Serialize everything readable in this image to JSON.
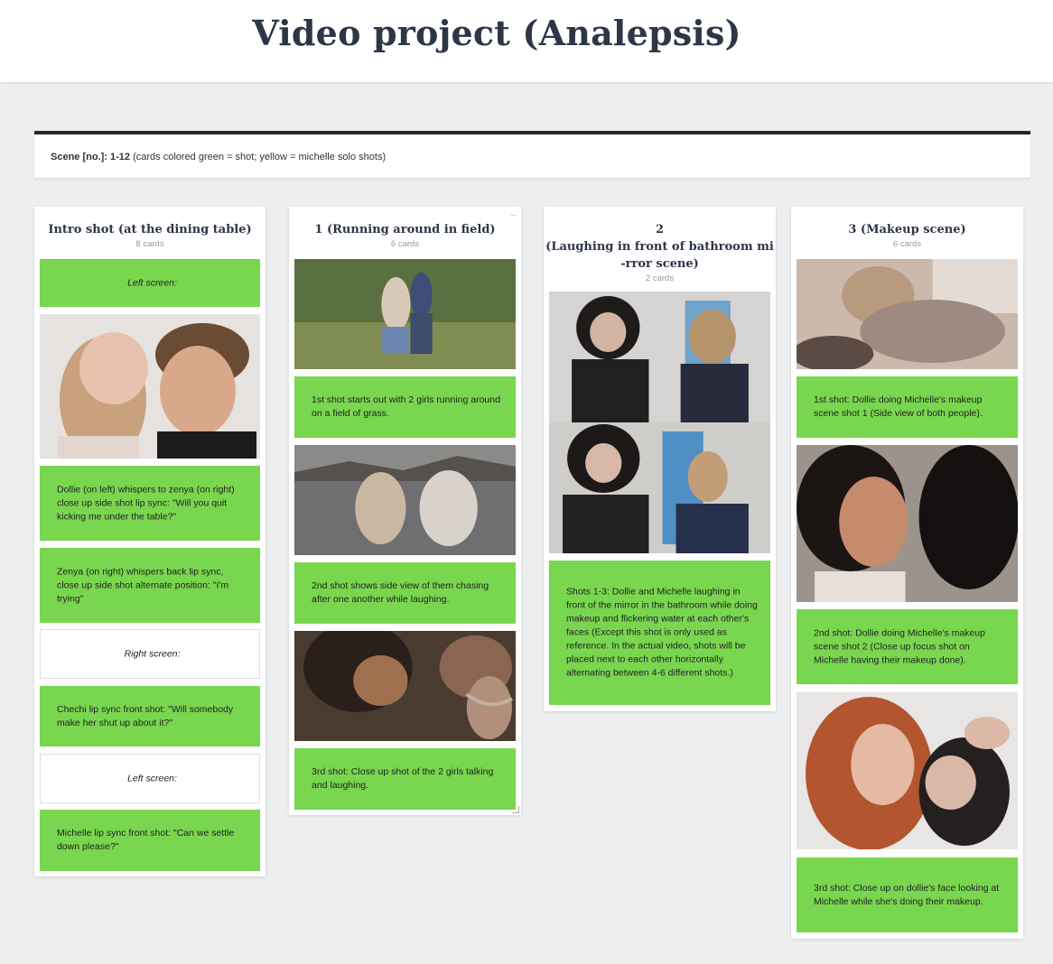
{
  "page": {
    "title": "Video project (Analepsis)"
  },
  "info": {
    "label": "Scene [no.]: 1-12",
    "description": " (cards colored green = shot; yellow = michelle solo shots)"
  },
  "colors": {
    "card_green": "#79d64f",
    "header_dark": "#25282c",
    "title_color": "#2d3646"
  },
  "columns": [
    {
      "title": "Intro shot (at the dining table)",
      "count": "8 cards",
      "cards": [
        {
          "type": "text",
          "color": "green",
          "text": "Left screen:"
        },
        {
          "type": "image",
          "description_icon": "image-icon"
        },
        {
          "type": "text",
          "color": "green",
          "text": "Dollie (on left) whispers to zenya (on right) close up side shot lip sync: \"Will you quit kicking me under the table?\""
        },
        {
          "type": "text",
          "color": "green",
          "text": "Zenya (on right) whispers back lip sync, close up side shot alternate position: \"I'm trying\""
        },
        {
          "type": "text",
          "color": "white",
          "text": "Right screen:"
        },
        {
          "type": "text",
          "color": "green",
          "text": "Chechi lip sync front shot: \"Will somebody make her shut up about it?\""
        },
        {
          "type": "text",
          "color": "white",
          "text": "Left screen:"
        },
        {
          "type": "text",
          "color": "green",
          "text": "Michelle lip sync front shot: \"Can we settle down please?\""
        }
      ]
    },
    {
      "title": "1 (Running around in field)",
      "count": "6 cards",
      "menu": "–",
      "cards": [
        {
          "type": "image"
        },
        {
          "type": "text",
          "color": "green",
          "text": "1st shot starts out with 2 girls running around on a field of grass."
        },
        {
          "type": "image"
        },
        {
          "type": "text",
          "color": "green",
          "text": "2nd shot shows side view of them chasing after one another while laughing."
        },
        {
          "type": "image"
        },
        {
          "type": "text",
          "color": "green",
          "text": "3rd shot: Close up shot of the 2 girls talking and laughing."
        }
      ]
    },
    {
      "title_line1": "2",
      "title_line2": "(Laughing in front of bathroom mi",
      "title_line3": "-rror scene)",
      "count": "2 cards",
      "cards": [
        {
          "type": "image"
        },
        {
          "type": "text",
          "color": "green",
          "text": "Shots 1-3: Dollie and Michelle laughing in front of the mirror in the bathroom while doing makeup and flickering water at each other's faces (Except this shot is only used as reference. In the actual video, shots will be placed next to each other horizontally alternating between 4-6 different shots.)"
        }
      ]
    },
    {
      "title": "3 (Makeup scene)",
      "count": "6 cards",
      "cards": [
        {
          "type": "image"
        },
        {
          "type": "text",
          "color": "green",
          "text": "1st shot: Dollie doing Michelle's makeup scene shot 1 (Side view of both people)."
        },
        {
          "type": "image"
        },
        {
          "type": "text",
          "color": "green",
          "text": "2nd shot: Dollie doing Michelle's makeup scene shot 2 (Close up focus shot on Michelle having their makeup done)."
        },
        {
          "type": "image"
        },
        {
          "type": "text",
          "color": "green",
          "text": "3rd shot: Close up on dollie's face looking at Michelle while she's doing their makeup."
        }
      ]
    }
  ]
}
